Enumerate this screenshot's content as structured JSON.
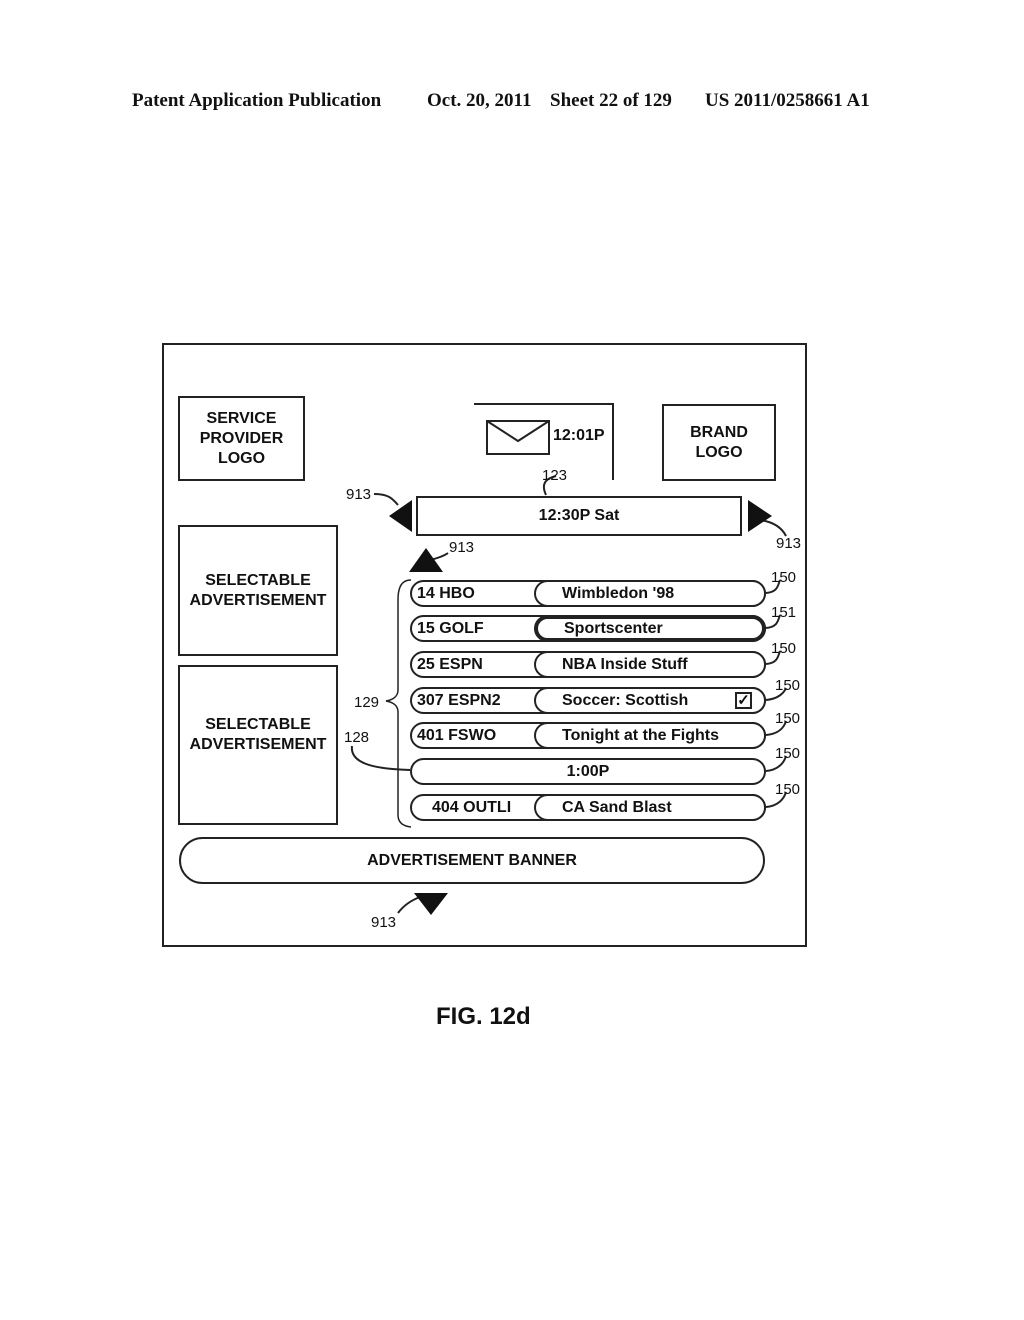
{
  "header": {
    "publication": "Patent Application Publication",
    "date": "Oct. 20, 2011",
    "sheet": "Sheet 22 of 129",
    "number": "US 2011/0258661 A1"
  },
  "screen": {
    "service_provider_logo": "SERVICE\nPROVIDER\nLOGO",
    "brand_logo": "BRAND\nLOGO",
    "mail_time": "12:01P",
    "time_bar": "12:30P Sat",
    "ads": [
      "SELECTABLE\nADVERTISEMENT",
      "SELECTABLE\nADVERTISEMENT"
    ],
    "guide_rows": [
      {
        "channel": "14 HBO",
        "program": "Wimbledon '98",
        "ref": "150",
        "selected": false,
        "checked": false
      },
      {
        "channel": "15 GOLF",
        "program": "Sportscenter",
        "ref": "151",
        "selected": true,
        "checked": false
      },
      {
        "channel": "25 ESPN",
        "program": "NBA Inside Stuff",
        "ref": "150",
        "selected": false,
        "checked": false
      },
      {
        "channel": "307 ESPN2",
        "program": "Soccer:  Scottish",
        "ref": "150",
        "selected": false,
        "checked": true
      },
      {
        "channel": "401 FSWO",
        "program": "Tonight at the Fights",
        "ref": "150",
        "selected": false,
        "checked": false
      }
    ],
    "time_row": {
      "label": "1:00P",
      "ref": "150"
    },
    "last_row": {
      "channel": "404 OUTLI",
      "program": "CA Sand Blast",
      "ref": "150"
    },
    "ad_banner": "ADVERTISEMENT BANNER"
  },
  "refs": {
    "nav_arrow": "913",
    "time_bar": "123",
    "guide_group": "129",
    "time_divider": "128"
  },
  "figure_label": "FIG. 12d"
}
